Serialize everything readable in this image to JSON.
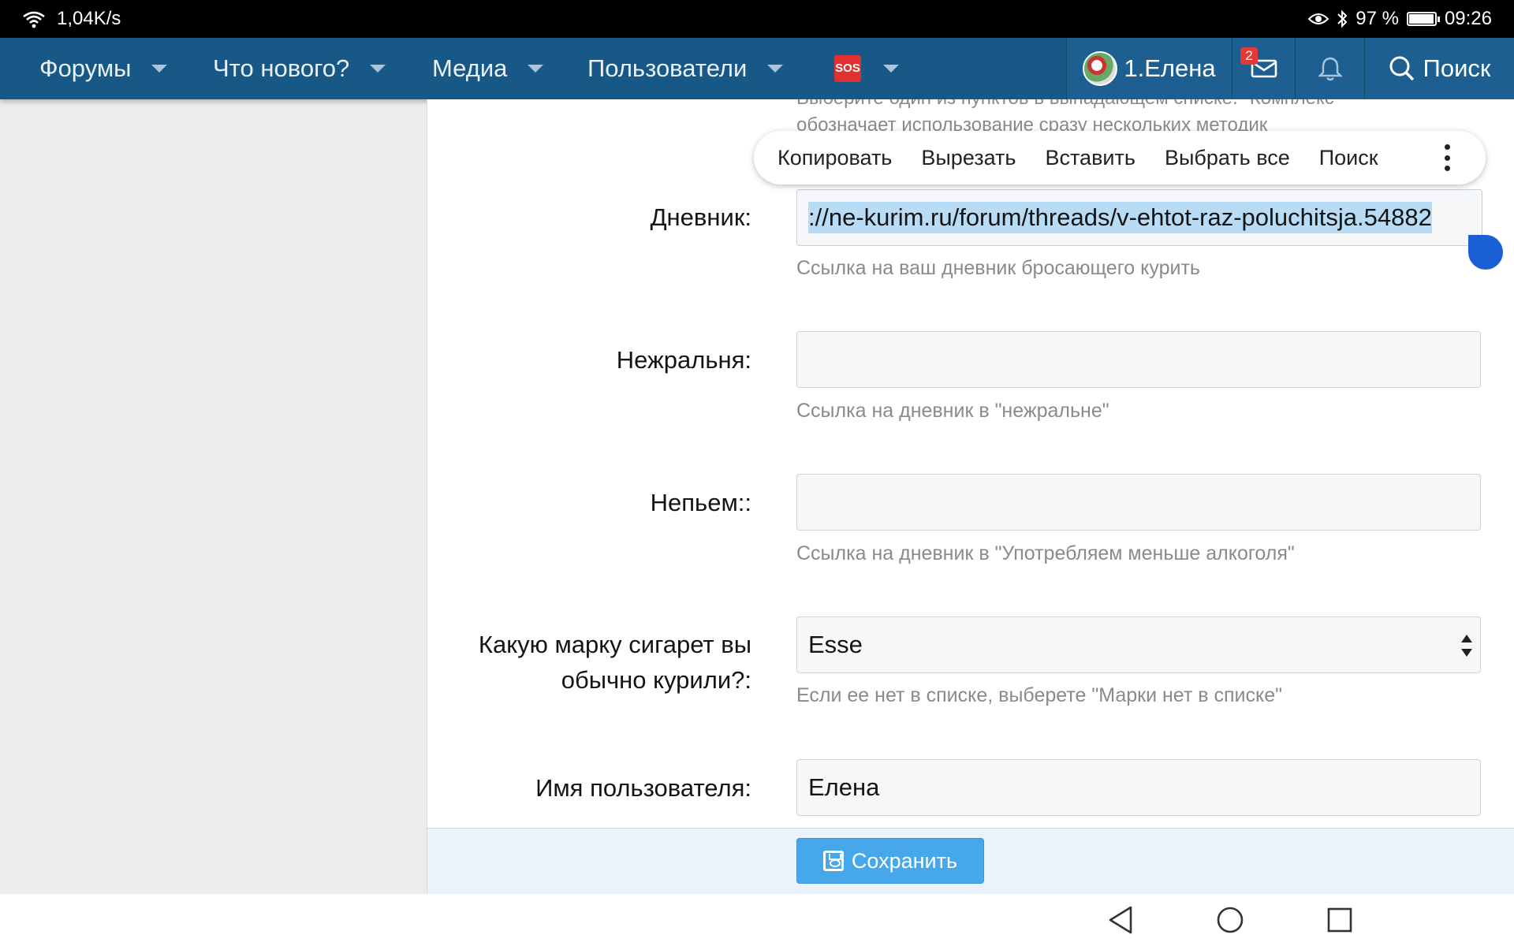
{
  "status_bar": {
    "net_speed": "1,04K/s",
    "battery_level": "97 %",
    "battery_fraction": 0.97,
    "time": "09:26",
    "icons": [
      "wifi-icon",
      "eye-icon",
      "bluetooth-icon",
      "battery-icon"
    ]
  },
  "nav": {
    "items": [
      {
        "label": "Форумы"
      },
      {
        "label": "Что нового?"
      },
      {
        "label": "Медиа"
      },
      {
        "label": "Пользователи"
      },
      {
        "label": "SOS"
      }
    ],
    "user_name": "1.Елена",
    "inbox_badge": "2",
    "search_label": "Поиск",
    "colors": {
      "bar": "#185886",
      "badge": "#e53935"
    }
  },
  "page": {
    "clipped_hint_line1": "Выберите один из пунктов в выпадающем списке. \"Комплекс\"",
    "clipped_hint_line2": "обозначает использование сразу нескольких методик"
  },
  "context_menu": {
    "items": [
      "Копировать",
      "Вырезать",
      "Вставить",
      "Выбрать все",
      "Поиск"
    ]
  },
  "form": {
    "diary": {
      "label": "Дневник:",
      "value": "://ne-kurim.ru/forum/threads/v-ehtot-raz-poluchitsja.54882",
      "hint": "Ссылка на ваш дневник бросающего курить"
    },
    "nezhralnya": {
      "label": "Нежральня:",
      "value": "",
      "hint": "Ссылка на дневник в \"нежральне\""
    },
    "nepyem": {
      "label": "Непьем::",
      "value": "",
      "hint": "Ссылка на дневник в \"Употребляем меньше алкоголя\""
    },
    "cigarette": {
      "label_line1": "Какую марку сигарет вы",
      "label_line2": "обычно курили?:",
      "value": "Esse",
      "hint": "Если ее нет в списке, выберете \"Марки нет в списке\""
    },
    "username": {
      "label": "Имя пользователя:",
      "value": "Елена"
    },
    "save_label": "Сохранить",
    "colors": {
      "save_button": "#47a7eb",
      "selection": "#b9dcf6"
    }
  }
}
